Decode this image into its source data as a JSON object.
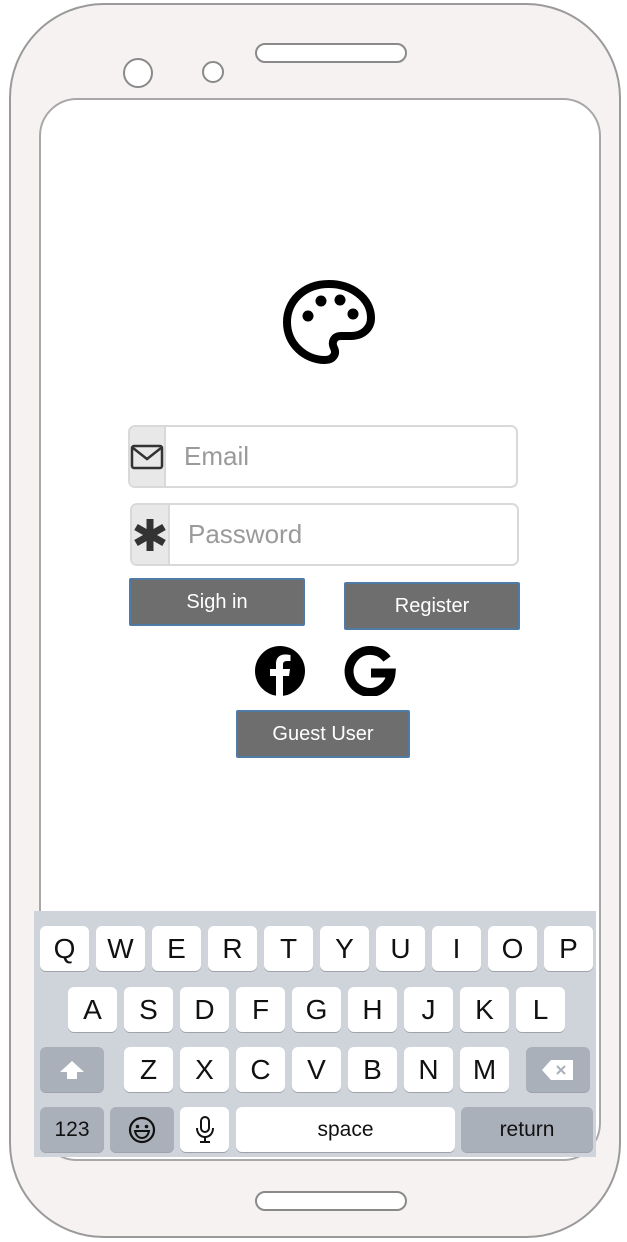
{
  "login": {
    "email_placeholder": "Email",
    "password_placeholder": "Password",
    "signin_label": "Sigh in",
    "register_label": "Register",
    "guest_label": "Guest User"
  },
  "icons": {
    "logo": "palette-icon",
    "email": "envelope-icon",
    "password": "asterisk-icon",
    "facebook": "facebook-icon",
    "google": "google-icon"
  },
  "keyboard": {
    "row1": [
      "Q",
      "W",
      "E",
      "R",
      "T",
      "Y",
      "U",
      "I",
      "O",
      "P"
    ],
    "row2": [
      "A",
      "S",
      "D",
      "F",
      "G",
      "H",
      "J",
      "K",
      "L"
    ],
    "row3": [
      "Z",
      "X",
      "C",
      "V",
      "B",
      "N",
      "M"
    ],
    "numbers_label": "123",
    "space_label": "space",
    "return_label": "return"
  },
  "colors": {
    "button_bg": "#6e6e6e",
    "button_border": "#4e7ba5",
    "keyboard_bg": "#cfd3da",
    "phone_body": "#f6f2f1"
  }
}
